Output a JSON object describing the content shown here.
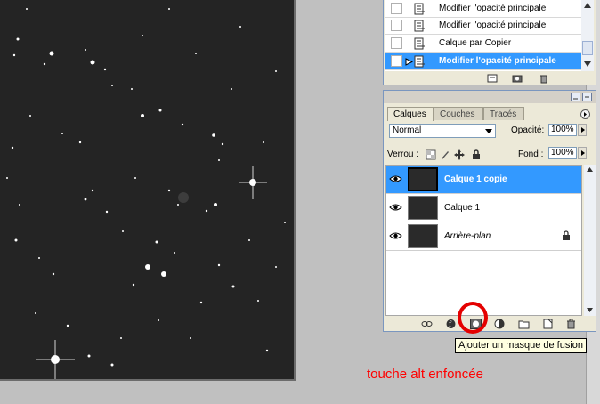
{
  "history": {
    "items": [
      {
        "label": "Modifier l'opacité principale",
        "active": false
      },
      {
        "label": "Modifier l'opacité principale",
        "active": false
      },
      {
        "label": "Calque par Copier",
        "active": false
      },
      {
        "label": "Modifier l'opacité principale",
        "active": true
      }
    ]
  },
  "layers_panel": {
    "tabs": [
      {
        "label": "Calques",
        "active": true
      },
      {
        "label": "Couches",
        "active": false
      },
      {
        "label": "Tracés",
        "active": false
      }
    ],
    "blend_mode": "Normal",
    "opacity_label": "Opacité:",
    "opacity_value": "100%",
    "lock_label": "Verrou :",
    "fill_label": "Fond :",
    "fill_value": "100%",
    "layers": [
      {
        "name": "Calque 1 copie",
        "active": true,
        "italic": false,
        "locked": false
      },
      {
        "name": "Calque 1",
        "active": false,
        "italic": false,
        "locked": false
      },
      {
        "name": "Arrière-plan",
        "active": false,
        "italic": true,
        "locked": true
      }
    ]
  },
  "tooltip": "Ajouter un masque de fusion",
  "annotation": "touche alt enfoncée",
  "colors": {
    "selection": "#3399ff",
    "annotation": "#ff0000",
    "panel": "#ece9d8"
  }
}
